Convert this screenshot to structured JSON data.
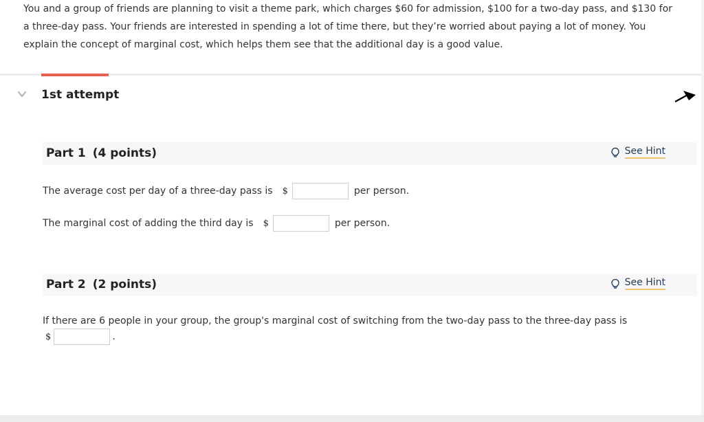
{
  "problem": {
    "intro": "You and a group of friends are planning to visit a theme park, which charges $60 for admission, $100 for a two-day pass, and $130 for a three-day pass. Your friends are interested in spending a lot of time there, but they’re worried about paying a lot of money. You explain the concept of marginal cost, which helps them see that the additional day is a good value."
  },
  "attempt": {
    "title": "1st attempt"
  },
  "part1": {
    "name": "Part 1",
    "points": "(4 points)",
    "hint_label": "See Hint",
    "q1_text": "The average cost per day of a three-day pass is",
    "q1_currency": "$",
    "q1_value": "",
    "q1_unit": "per person.",
    "q2_text": "The marginal cost of adding the third day is",
    "q2_currency": "$",
    "q2_value": "",
    "q2_unit": "per person."
  },
  "part2": {
    "name": "Part 2",
    "points": "(2 points)",
    "hint_label": "See Hint",
    "q_text": "If there are 6 people in your group, the group's marginal cost of switching from the two-day pass to the three-day pass is",
    "currency": "$",
    "value": "",
    "end": "."
  },
  "colors": {
    "accent": "#e4624f",
    "hint_underline": "#f0c36a",
    "hint_text": "#1f3b57"
  },
  "icons": {
    "collapse": "chevron-down-icon",
    "hint": "lightbulb-icon",
    "cursor": "arrow-cursor-icon"
  }
}
